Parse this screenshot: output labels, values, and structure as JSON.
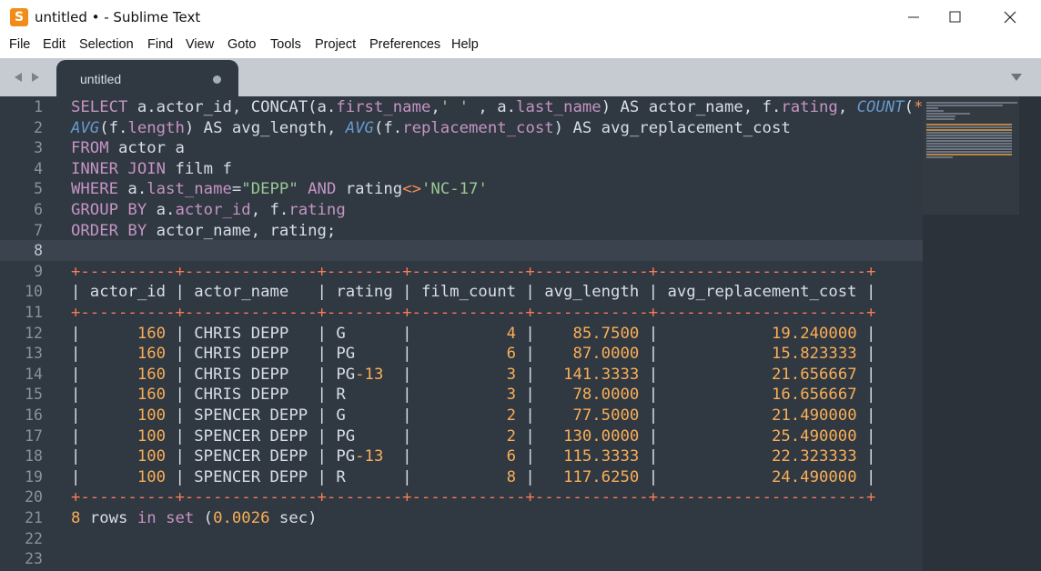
{
  "window": {
    "title": "untitled • - Sublime Text",
    "icon_glyph": "S",
    "controls": {
      "minimize": "—",
      "maximize": "☐",
      "close": "✕"
    }
  },
  "menu": [
    "File",
    "Edit",
    "Selection",
    "Find",
    "View",
    "Goto",
    "Tools",
    "Project",
    "Preferences",
    "Help"
  ],
  "tab": {
    "label": "untitled",
    "dirty_indicator": "dot"
  },
  "nav_icons": [
    "chevron-left-icon",
    "chevron-right-icon",
    "tab-menu-icon"
  ],
  "colors": {
    "editor_bg": "#303841",
    "keyword": "#c594c5",
    "function": "#6699cc",
    "string": "#99c794",
    "operator": "#f99157",
    "number": "#f9ae58",
    "text": "#d8dee9"
  },
  "editor": {
    "line_numbers": [
      "1",
      "2",
      "3",
      "4",
      "5",
      "6",
      "7",
      "8",
      "9",
      "10",
      "11",
      "12",
      "13",
      "14",
      "15",
      "16",
      "17",
      "18",
      "19",
      "20",
      "21",
      "22",
      "23"
    ],
    "current_line": "8",
    "lines": [
      [
        {
          "t": "SELECT",
          "c": "kw"
        },
        {
          "t": " a.actor_id, CONCAT(a.",
          "c": ""
        },
        {
          "t": "first_name",
          "c": "kw"
        },
        {
          "t": ",",
          "c": ""
        },
        {
          "t": "' '",
          "c": "str"
        },
        {
          "t": " , a.",
          "c": ""
        },
        {
          "t": "last_name",
          "c": "kw"
        },
        {
          "t": ") AS actor_name, f.",
          "c": ""
        },
        {
          "t": "rating",
          "c": "kw"
        },
        {
          "t": ", ",
          "c": ""
        },
        {
          "t": "COUNT",
          "c": "fn"
        },
        {
          "t": "(",
          "c": ""
        },
        {
          "t": "*",
          "c": "op"
        },
        {
          "t": ")",
          "c": ""
        }
      ],
      [
        {
          "t": "AVG",
          "c": "fn"
        },
        {
          "t": "(f.",
          "c": ""
        },
        {
          "t": "length",
          "c": "kw"
        },
        {
          "t": ") AS avg_length, ",
          "c": ""
        },
        {
          "t": "AVG",
          "c": "fn"
        },
        {
          "t": "(f.",
          "c": ""
        },
        {
          "t": "replacement_cost",
          "c": "kw"
        },
        {
          "t": ") AS avg_replacement_cost",
          "c": ""
        }
      ],
      [
        {
          "t": "FROM",
          "c": "kw"
        },
        {
          "t": " actor a",
          "c": ""
        }
      ],
      [
        {
          "t": "INNER JOIN",
          "c": "kw"
        },
        {
          "t": " film f",
          "c": ""
        }
      ],
      [
        {
          "t": "WHERE",
          "c": "kw"
        },
        {
          "t": " a.",
          "c": ""
        },
        {
          "t": "last_name",
          "c": "kw"
        },
        {
          "t": "=",
          "c": ""
        },
        {
          "t": "\"DEPP\"",
          "c": "str"
        },
        {
          "t": " ",
          "c": ""
        },
        {
          "t": "AND",
          "c": "kw"
        },
        {
          "t": " rating",
          "c": ""
        },
        {
          "t": "<>",
          "c": "op"
        },
        {
          "t": "'NC-17'",
          "c": "str"
        }
      ],
      [
        {
          "t": "GROUP BY",
          "c": "kw"
        },
        {
          "t": " a.",
          "c": ""
        },
        {
          "t": "actor_id",
          "c": "kw"
        },
        {
          "t": ", f.",
          "c": ""
        },
        {
          "t": "rating",
          "c": "kw"
        }
      ],
      [
        {
          "t": "ORDER BY",
          "c": "kw"
        },
        {
          "t": " actor_name, rating;",
          "c": ""
        }
      ],
      [],
      [
        {
          "t": "+----------+--------------+--------+------------+------------+----------------------+",
          "c": "plus"
        }
      ],
      [
        {
          "t": "| actor_id | actor_name   | rating | film_count | avg_length | avg_replacement_cost |",
          "c": ""
        }
      ],
      [
        {
          "t": "+----------+--------------+--------+------------+------------+----------------------+",
          "c": "plus"
        }
      ],
      [
        {
          "t": "|      ",
          "c": ""
        },
        {
          "t": "160",
          "c": "num"
        },
        {
          "t": " | CHRIS DEPP   | G      |          ",
          "c": ""
        },
        {
          "t": "4",
          "c": "num"
        },
        {
          "t": " |    ",
          "c": ""
        },
        {
          "t": "85.7500",
          "c": "num"
        },
        {
          "t": " |            ",
          "c": ""
        },
        {
          "t": "19.240000",
          "c": "num"
        },
        {
          "t": " |",
          "c": ""
        }
      ],
      [
        {
          "t": "|      ",
          "c": ""
        },
        {
          "t": "160",
          "c": "num"
        },
        {
          "t": " | CHRIS DEPP   | PG     |          ",
          "c": ""
        },
        {
          "t": "6",
          "c": "num"
        },
        {
          "t": " |    ",
          "c": ""
        },
        {
          "t": "87.0000",
          "c": "num"
        },
        {
          "t": " |            ",
          "c": ""
        },
        {
          "t": "15.823333",
          "c": "num"
        },
        {
          "t": " |",
          "c": ""
        }
      ],
      [
        {
          "t": "|      ",
          "c": ""
        },
        {
          "t": "160",
          "c": "num"
        },
        {
          "t": " | CHRIS DEPP   | PG",
          "c": ""
        },
        {
          "t": "-13",
          "c": "num"
        },
        {
          "t": "  |          ",
          "c": ""
        },
        {
          "t": "3",
          "c": "num"
        },
        {
          "t": " |   ",
          "c": ""
        },
        {
          "t": "141.3333",
          "c": "num"
        },
        {
          "t": " |            ",
          "c": ""
        },
        {
          "t": "21.656667",
          "c": "num"
        },
        {
          "t": " |",
          "c": ""
        }
      ],
      [
        {
          "t": "|      ",
          "c": ""
        },
        {
          "t": "160",
          "c": "num"
        },
        {
          "t": " | CHRIS DEPP   | R      |          ",
          "c": ""
        },
        {
          "t": "3",
          "c": "num"
        },
        {
          "t": " |    ",
          "c": ""
        },
        {
          "t": "78.0000",
          "c": "num"
        },
        {
          "t": " |            ",
          "c": ""
        },
        {
          "t": "16.656667",
          "c": "num"
        },
        {
          "t": " |",
          "c": ""
        }
      ],
      [
        {
          "t": "|      ",
          "c": ""
        },
        {
          "t": "100",
          "c": "num"
        },
        {
          "t": " | SPENCER DEPP | G      |          ",
          "c": ""
        },
        {
          "t": "2",
          "c": "num"
        },
        {
          "t": " |    ",
          "c": ""
        },
        {
          "t": "77.5000",
          "c": "num"
        },
        {
          "t": " |            ",
          "c": ""
        },
        {
          "t": "21.490000",
          "c": "num"
        },
        {
          "t": " |",
          "c": ""
        }
      ],
      [
        {
          "t": "|      ",
          "c": ""
        },
        {
          "t": "100",
          "c": "num"
        },
        {
          "t": " | SPENCER DEPP | PG     |          ",
          "c": ""
        },
        {
          "t": "2",
          "c": "num"
        },
        {
          "t": " |   ",
          "c": ""
        },
        {
          "t": "130.0000",
          "c": "num"
        },
        {
          "t": " |            ",
          "c": ""
        },
        {
          "t": "25.490000",
          "c": "num"
        },
        {
          "t": " |",
          "c": ""
        }
      ],
      [
        {
          "t": "|      ",
          "c": ""
        },
        {
          "t": "100",
          "c": "num"
        },
        {
          "t": " | SPENCER DEPP | PG",
          "c": ""
        },
        {
          "t": "-13",
          "c": "num"
        },
        {
          "t": "  |          ",
          "c": ""
        },
        {
          "t": "6",
          "c": "num"
        },
        {
          "t": " |   ",
          "c": ""
        },
        {
          "t": "115.3333",
          "c": "num"
        },
        {
          "t": " |            ",
          "c": ""
        },
        {
          "t": "22.323333",
          "c": "num"
        },
        {
          "t": " |",
          "c": ""
        }
      ],
      [
        {
          "t": "|      ",
          "c": ""
        },
        {
          "t": "100",
          "c": "num"
        },
        {
          "t": " | SPENCER DEPP | R      |          ",
          "c": ""
        },
        {
          "t": "8",
          "c": "num"
        },
        {
          "t": " |   ",
          "c": ""
        },
        {
          "t": "117.6250",
          "c": "num"
        },
        {
          "t": " |            ",
          "c": ""
        },
        {
          "t": "24.490000",
          "c": "num"
        },
        {
          "t": " |",
          "c": ""
        }
      ],
      [
        {
          "t": "+----------+--------------+--------+------------+------------+----------------------+",
          "c": "plus"
        }
      ],
      [
        {
          "t": "8",
          "c": "num"
        },
        {
          "t": " rows ",
          "c": ""
        },
        {
          "t": "in",
          "c": "kw"
        },
        {
          "t": " ",
          "c": ""
        },
        {
          "t": "set",
          "c": "kw"
        },
        {
          "t": " (",
          "c": ""
        },
        {
          "t": "0.0026",
          "c": "num"
        },
        {
          "t": " sec)",
          "c": ""
        }
      ],
      [],
      []
    ]
  }
}
